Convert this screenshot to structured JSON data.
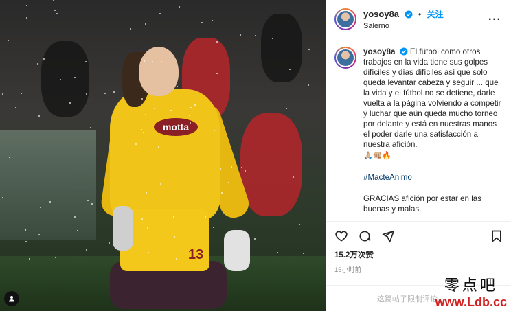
{
  "post": {
    "username": "yosoy8a",
    "follow_label": "关注",
    "dot": "•",
    "location": "Salerno",
    "more_label": "···",
    "caption": {
      "username": "yosoy8a",
      "text": "El fútbol como otros trabajos en la vida tiene sus golpes difíciles y días difíciles así que solo queda levantar cabeza y seguir ... que la vida y el fútbol no se detiene, darle vuelta a la página volviendo a competir y luchar que aún queda mucho torneo por delante y está en nuestras manos el poder darle una satisfacción a nuestra afición.",
      "emoji": "🙏🏼👊🏼🔥",
      "hashtag": "#MacteAnimo",
      "closing": "GRACIAS afición por estar en las buenas y malas."
    },
    "likes": "15.2万次赞",
    "time": "15小时前",
    "comment_notice": "这篇帖子限制评论。"
  },
  "media": {
    "sponsor": "motta",
    "number": "13"
  },
  "watermark": {
    "cn": "零点吧",
    "url": "www.Ldb.cc"
  },
  "colors": {
    "accent": "#0095f6",
    "kit": "#f0c419",
    "club": "#8a1f26"
  }
}
